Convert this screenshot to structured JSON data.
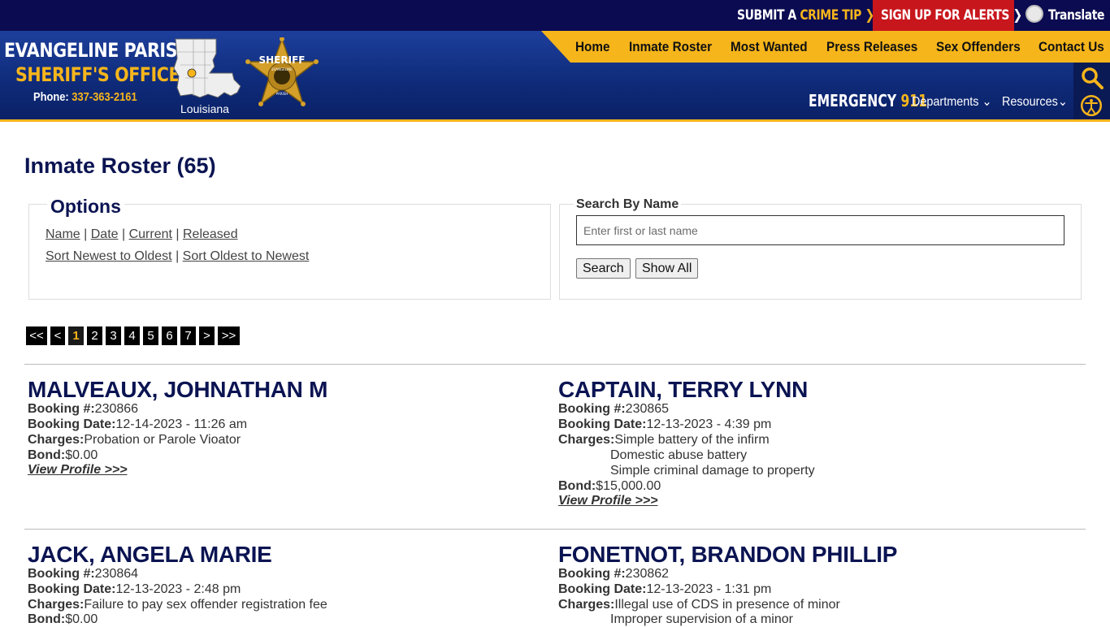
{
  "topbar": {
    "tip_prefix": "SUBMIT A ",
    "tip_accent": "CRIME TIP",
    "alerts": "SIGN UP FOR ALERTS",
    "translate": "Translate",
    "chevron": "❯"
  },
  "brand": {
    "line1": "EVANGELINE PARISH",
    "line2": "SHERIFF'S OFFICE",
    "phone_label": "Phone: ",
    "phone_number": "337-363-2161",
    "state_label": "Louisiana",
    "badge_text": "SHERIFF",
    "badge_small": "EVANGELINE",
    "badge_small2": "PARISH"
  },
  "nav": {
    "home": "Home",
    "roster": "Inmate Roster",
    "wanted": "Most Wanted",
    "press": "Press Releases",
    "offenders": "Sex Offenders",
    "contact": "Contact Us"
  },
  "subnav": {
    "emergency_label": "EMERGENCY ",
    "emergency_num": "911",
    "departments": "Departments",
    "resources": "Resources",
    "caret": "⌄"
  },
  "page": {
    "title": "Inmate Roster (65)"
  },
  "options": {
    "legend": "Options",
    "filters": [
      "Name",
      "Date",
      "Current",
      "Released"
    ],
    "sort_newest": "Sort Newest to Oldest",
    "sort_oldest": "Sort Oldest to Newest",
    "sep": " | "
  },
  "search": {
    "legend": "Search By Name",
    "placeholder": "Enter first or last name",
    "search_btn": "Search",
    "show_all_btn": "Show All"
  },
  "pagination": {
    "first": "<<",
    "prev": "<",
    "pages": [
      "1",
      "2",
      "3",
      "4",
      "5",
      "6",
      "7"
    ],
    "current": "1",
    "next": ">",
    "last": ">>"
  },
  "labels": {
    "booking_no": "Booking #:",
    "booking_date": "Booking Date:",
    "charges": "Charges:",
    "bond": "Bond:",
    "view_profile": "View Profile >>>"
  },
  "inmates": [
    {
      "name": "MALVEAUX, JOHNATHAN M",
      "booking_no": "230866",
      "booking_date": "12-14-2023 - 11:26 am",
      "charges": [
        "Probation or Parole Vioator"
      ],
      "bond": "$0.00"
    },
    {
      "name": "CAPTAIN, TERRY LYNN",
      "booking_no": "230865",
      "booking_date": "12-13-2023 - 4:39 pm",
      "charges": [
        "Simple battery of the infirm",
        "Domestic abuse battery",
        "Simple criminal damage to property"
      ],
      "bond": "$15,000.00"
    },
    {
      "name": "JACK, ANGELA MARIE",
      "booking_no": "230864",
      "booking_date": "12-13-2023 - 2:48 pm",
      "charges": [
        "Failure to pay sex offender registration fee"
      ],
      "bond": "$0.00"
    },
    {
      "name": "FONETNOT, BRANDON PHILLIP",
      "booking_no": "230862",
      "booking_date": "12-13-2023 - 1:31 pm",
      "charges": [
        "Illegal use of CDS in presence of minor",
        "Improper supervision of a minor"
      ],
      "bond": ""
    }
  ]
}
